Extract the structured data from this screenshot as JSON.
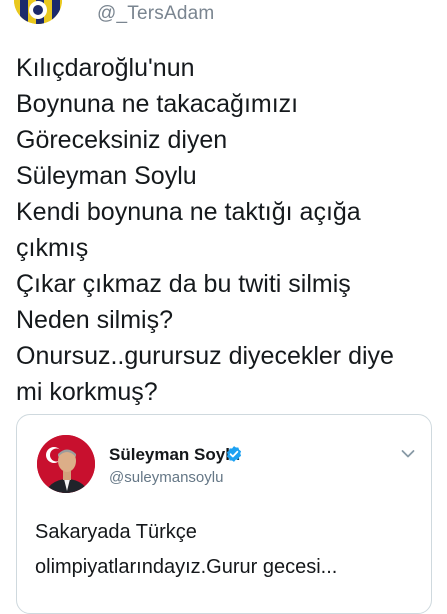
{
  "tweet": {
    "author_handle": "@_TersAdam",
    "text_lines": [
      "Kılıçdaroğlu'nun",
      "Boynuna ne takacağımızı",
      "Göreceksiniz diyen",
      "Süleyman Soylu",
      "Kendi boynuna ne taktığı açığa",
      "çıkmış",
      "Çıkar çıkmaz da bu twiti silmiş",
      "Neden silmiş?",
      "Onursuz..gurursuz diyecekler diye",
      "mi korkmuş?"
    ]
  },
  "quoted_tweet": {
    "name": "Süleyman Soylu",
    "handle": "@suleymansoylu",
    "verified": true,
    "text_lines": [
      "Sakaryada Türkçe",
      "olimpiyatlarındayız.Gurur gecesi..."
    ]
  },
  "icons": {
    "author_avatar": "club-crest-avatar",
    "quoted_avatar": "profile-photo-avatar",
    "verified": "verified-badge-icon",
    "menu": "chevron-down-icon"
  },
  "colors": {
    "text": "#14171a",
    "secondary_text": "#657786",
    "border": "#cfd9de",
    "verified_blue": "#1da1f2",
    "author_avatar_yellow": "#e9c81f",
    "author_avatar_navy": "#1c2a6b",
    "quoted_avatar_red": "#c8102e"
  }
}
